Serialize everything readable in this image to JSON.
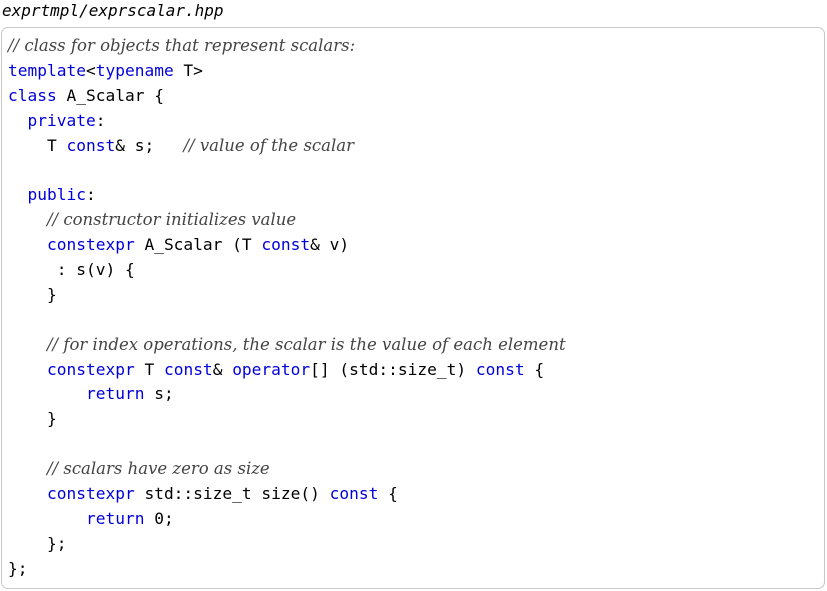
{
  "file": {
    "name": "exprtmpl/exprscalar.hpp"
  },
  "code": {
    "lines": [
      [
        {
          "t": "cm",
          "v": "// class for objects that represent scalars:"
        }
      ],
      [
        {
          "t": "kw",
          "v": "template"
        },
        {
          "t": "p",
          "v": "<"
        },
        {
          "t": "kw",
          "v": "typename"
        },
        {
          "t": "p",
          "v": " T>"
        }
      ],
      [
        {
          "t": "kw",
          "v": "class"
        },
        {
          "t": "p",
          "v": " A_Scalar {"
        }
      ],
      [
        {
          "t": "p",
          "v": "  "
        },
        {
          "t": "kw",
          "v": "private"
        },
        {
          "t": "p",
          "v": ":"
        }
      ],
      [
        {
          "t": "p",
          "v": "    T "
        },
        {
          "t": "kw",
          "v": "const"
        },
        {
          "t": "p",
          "v": "& s;   "
        },
        {
          "t": "cm",
          "v": "// value of the scalar"
        }
      ],
      [],
      [
        {
          "t": "p",
          "v": "  "
        },
        {
          "t": "kw",
          "v": "public"
        },
        {
          "t": "p",
          "v": ":"
        }
      ],
      [
        {
          "t": "p",
          "v": "    "
        },
        {
          "t": "cm",
          "v": "// constructor initializes value"
        }
      ],
      [
        {
          "t": "p",
          "v": "    "
        },
        {
          "t": "kw",
          "v": "constexpr"
        },
        {
          "t": "p",
          "v": " A_Scalar (T "
        },
        {
          "t": "kw",
          "v": "const"
        },
        {
          "t": "p",
          "v": "& v)"
        }
      ],
      [
        {
          "t": "p",
          "v": "     : s(v) {"
        }
      ],
      [
        {
          "t": "p",
          "v": "    }"
        }
      ],
      [],
      [
        {
          "t": "p",
          "v": "    "
        },
        {
          "t": "cm",
          "v": "// for index operations, the scalar is the value of each element"
        }
      ],
      [
        {
          "t": "p",
          "v": "    "
        },
        {
          "t": "kw",
          "v": "constexpr"
        },
        {
          "t": "p",
          "v": " T "
        },
        {
          "t": "kw",
          "v": "const"
        },
        {
          "t": "p",
          "v": "& "
        },
        {
          "t": "kw",
          "v": "operator"
        },
        {
          "t": "p",
          "v": "[] (std::size_t) "
        },
        {
          "t": "kw",
          "v": "const"
        },
        {
          "t": "p",
          "v": " {"
        }
      ],
      [
        {
          "t": "p",
          "v": "        "
        },
        {
          "t": "kw",
          "v": "return"
        },
        {
          "t": "p",
          "v": " s;"
        }
      ],
      [
        {
          "t": "p",
          "v": "    }"
        }
      ],
      [],
      [
        {
          "t": "p",
          "v": "    "
        },
        {
          "t": "cm",
          "v": "// scalars have zero as size"
        }
      ],
      [
        {
          "t": "p",
          "v": "    "
        },
        {
          "t": "kw",
          "v": "constexpr"
        },
        {
          "t": "p",
          "v": " std::size_t size() "
        },
        {
          "t": "kw",
          "v": "const"
        },
        {
          "t": "p",
          "v": " {"
        }
      ],
      [
        {
          "t": "p",
          "v": "        "
        },
        {
          "t": "kw",
          "v": "return"
        },
        {
          "t": "p",
          "v": " 0;"
        }
      ],
      [
        {
          "t": "p",
          "v": "    };"
        }
      ],
      [
        {
          "t": "p",
          "v": "};"
        }
      ]
    ]
  }
}
